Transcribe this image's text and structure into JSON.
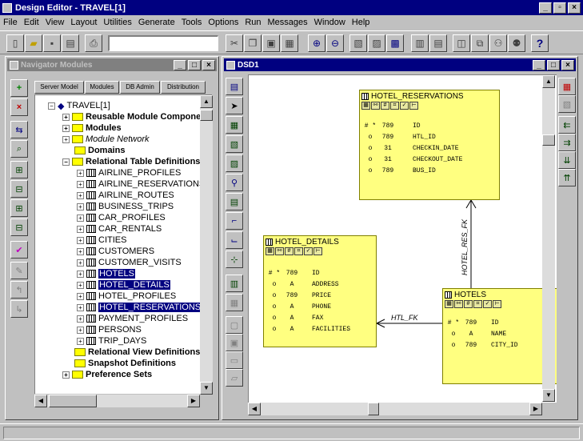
{
  "app": {
    "title": "Design Editor - TRAVEL[1]"
  },
  "menu": [
    "File",
    "Edit",
    "View",
    "Layout",
    "Utilities",
    "Generate",
    "Tools",
    "Options",
    "Run",
    "Messages",
    "Window",
    "Help"
  ],
  "toolbar": {
    "help_label": "?"
  },
  "navigator": {
    "title": "Navigator  Modules",
    "tabs": [
      "Server Model",
      "Modules",
      "DB Admin",
      "Distribution"
    ],
    "root": "TRAVEL[1]",
    "folders_top": [
      "Reusable Module Components",
      "Modules",
      "Module Network",
      "Domains",
      "Relational Table Definitions"
    ],
    "tables": [
      "AIRLINE_PROFILES",
      "AIRLINE_RESERVATIONS",
      "AIRLINE_ROUTES",
      "BUSINESS_TRIPS",
      "CAR_PROFILES",
      "CAR_RENTALS",
      "CITIES",
      "CUSTOMERS",
      "CUSTOMER_VISITS",
      "HOTELS",
      "HOTEL_DETAILS",
      "HOTEL_PROFILES",
      "HOTEL_RESERVATIONS",
      "PAYMENT_PROFILES",
      "PERSONS",
      "TRIP_DAYS"
    ],
    "folders_bottom": [
      "Relational View Definitions",
      "Snapshot Definitions",
      "Preference Sets"
    ]
  },
  "diagram": {
    "title": "DSD1",
    "entities": {
      "hotel_reservations": {
        "name": "HOTEL_RESERVATIONS",
        "columns": [
          {
            "key": "# *",
            "type": "789",
            "name": "ID"
          },
          {
            "key": "o",
            "type": "789",
            "name": "HTL_ID"
          },
          {
            "key": "o",
            "type": "31",
            "name": "CHECKIN_DATE"
          },
          {
            "key": "o",
            "type": "31",
            "name": "CHECKOUT_DATE"
          },
          {
            "key": "o",
            "type": "789",
            "name": "BUS_ID"
          }
        ]
      },
      "hotel_details": {
        "name": "HOTEL_DETAILS",
        "columns": [
          {
            "key": "# *",
            "type": "789",
            "name": "ID"
          },
          {
            "key": "o",
            "type": "A",
            "name": "ADDRESS"
          },
          {
            "key": "o",
            "type": "789",
            "name": "PRICE"
          },
          {
            "key": "o",
            "type": "A",
            "name": "PHONE"
          },
          {
            "key": "o",
            "type": "A",
            "name": "FAX"
          },
          {
            "key": "o",
            "type": "A",
            "name": "FACILITIES"
          }
        ]
      },
      "hotels": {
        "name": "HOTELS",
        "columns": [
          {
            "key": "# *",
            "type": "789",
            "name": "ID"
          },
          {
            "key": "o",
            "type": "A",
            "name": "NAME"
          },
          {
            "key": "o",
            "type": "789",
            "name": "CITY_ID"
          }
        ]
      }
    },
    "relations": {
      "res_fk": "HOTEL_RES_FK",
      "htl_fk": "HTL_FK"
    }
  }
}
